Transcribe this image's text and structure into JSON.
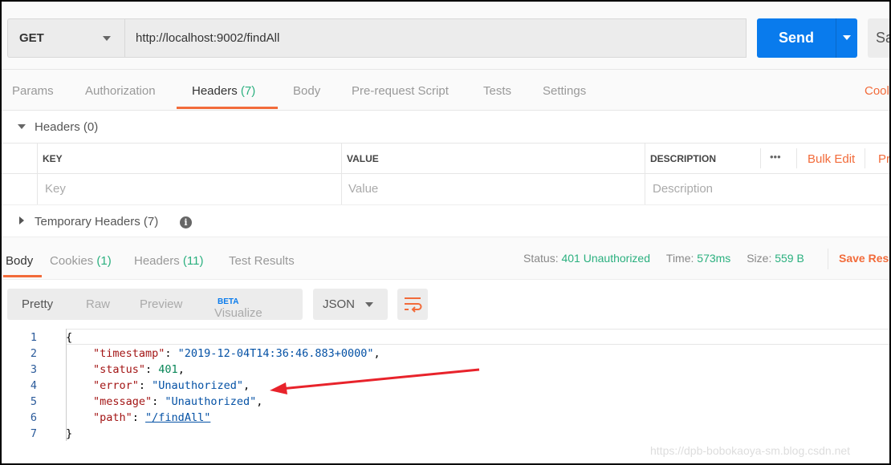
{
  "request": {
    "method": "GET",
    "url": "http://localhost:9002/findAll",
    "send_label": "Send",
    "save_label": "Sa"
  },
  "request_tabs": [
    {
      "label": "Params"
    },
    {
      "label": "Authorization"
    },
    {
      "label": "Headers",
      "count": "(7)"
    },
    {
      "label": "Body"
    },
    {
      "label": "Pre-request Script"
    },
    {
      "label": "Tests"
    },
    {
      "label": "Settings"
    }
  ],
  "cookies_link": "Cool",
  "headers_section": {
    "title": "Headers (0)",
    "columns": [
      "KEY",
      "VALUE",
      "DESCRIPTION"
    ],
    "more": "•••",
    "bulk_edit": "Bulk Edit",
    "presets": "Pr",
    "placeholders": {
      "key": "Key",
      "value": "Value",
      "description": "Description"
    }
  },
  "temp_headers": {
    "title": "Temporary Headers (7)",
    "info": "i"
  },
  "response_tabs": [
    {
      "label": "Body"
    },
    {
      "label": "Cookies",
      "count": "(1)"
    },
    {
      "label": "Headers",
      "count": "(11)"
    },
    {
      "label": "Test Results"
    }
  ],
  "response_status": {
    "status_label": "Status:",
    "status": "401 Unauthorized",
    "time_label": "Time:",
    "time": "573ms",
    "size_label": "Size:",
    "size": "559 B",
    "save_response": "Save Res"
  },
  "view_modes": {
    "pretty": "Pretty",
    "raw": "Raw",
    "preview": "Preview",
    "visualize": "Visualize",
    "beta": "BETA",
    "format": "JSON"
  },
  "body_lines": [
    {
      "n": "1",
      "t": "{"
    },
    {
      "n": "2",
      "k": "\"timestamp\"",
      "v": "\"2019-12-04T14:36:46.883+0000\"",
      "c": ","
    },
    {
      "n": "3",
      "k": "\"status\"",
      "v": "401",
      "c": ","
    },
    {
      "n": "4",
      "k": "\"error\"",
      "v": "\"Unauthorized\"",
      "c": ","
    },
    {
      "n": "5",
      "k": "\"message\"",
      "v": "\"Unauthorized\"",
      "c": ","
    },
    {
      "n": "6",
      "k": "\"path\"",
      "v": "\"/findAll\"",
      "c": ""
    },
    {
      "n": "7",
      "t": "}"
    }
  ],
  "watermark": "https://dpb-bobokaoya-sm.blog.csdn.net",
  "colors": {
    "accent": "#f26b3a",
    "send": "#097bed",
    "success": "#2bb07f",
    "annotation_arrow": "#e8232b"
  }
}
